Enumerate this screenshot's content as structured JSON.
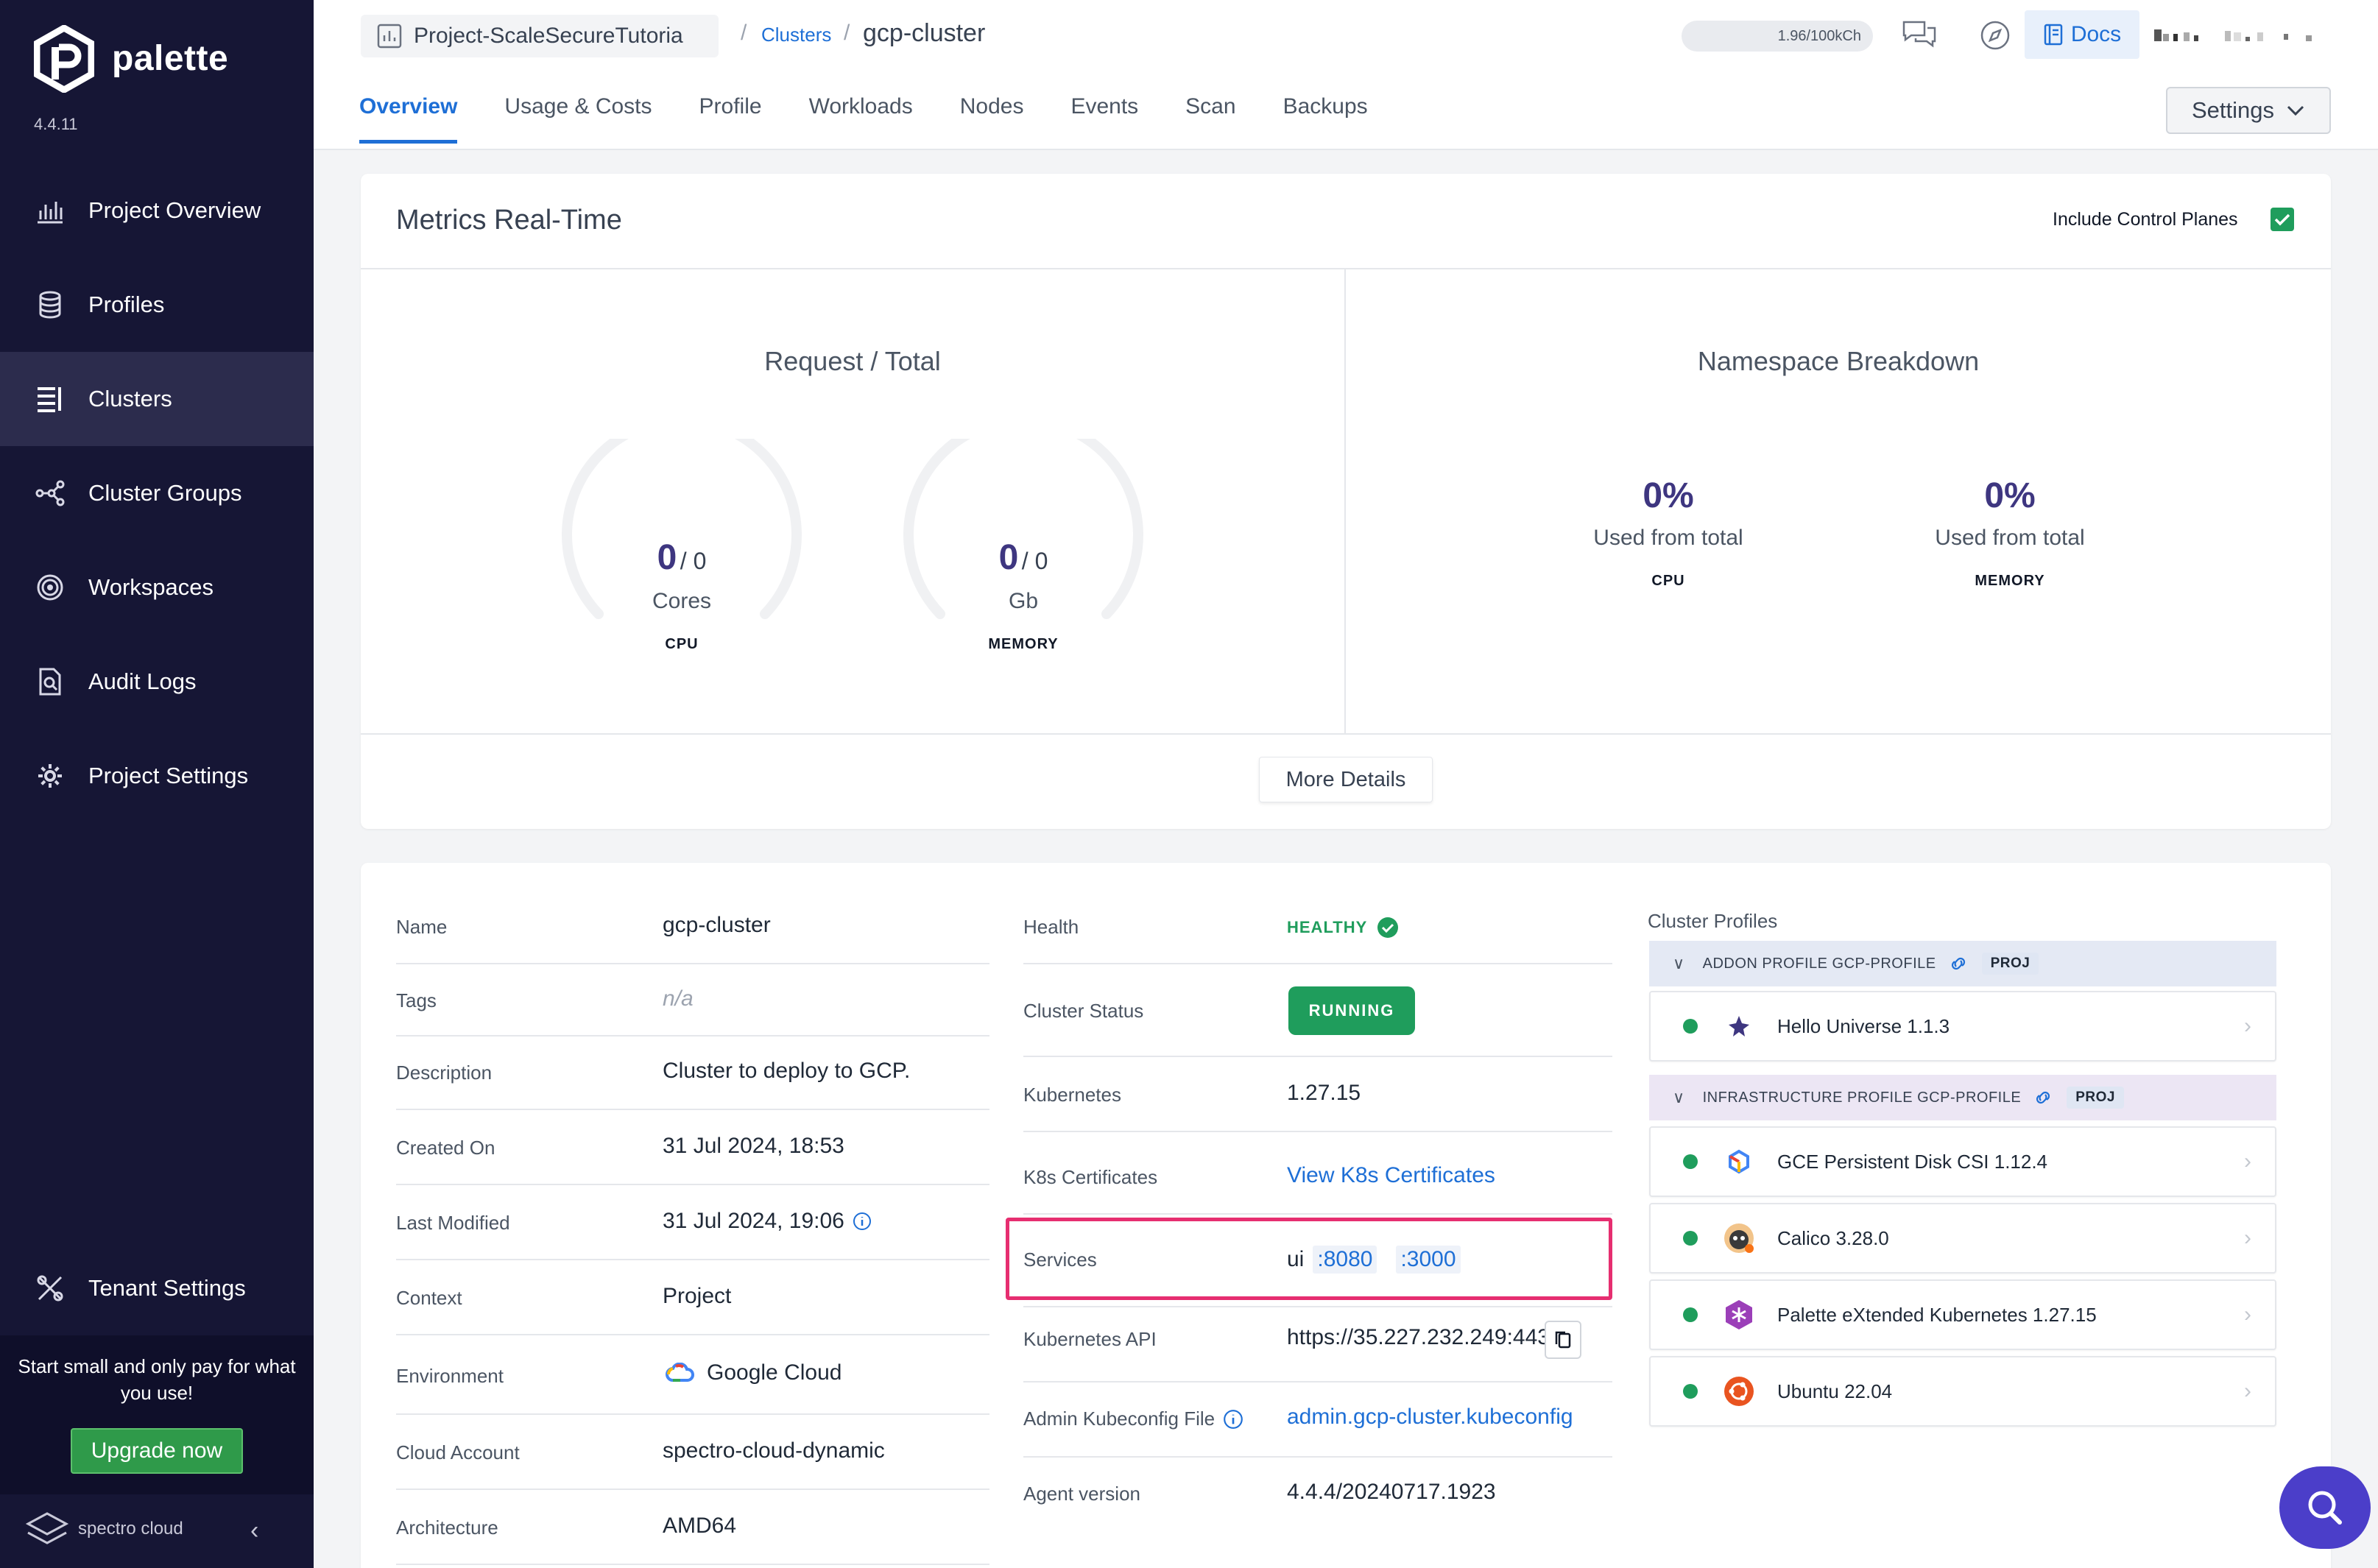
{
  "app": {
    "name": "palette",
    "version": "4.4.11",
    "brand_footer": "spectro cloud"
  },
  "sidebar": {
    "items": [
      {
        "label": "Project Overview",
        "icon": "chart-icon"
      },
      {
        "label": "Profiles",
        "icon": "layers-icon"
      },
      {
        "label": "Clusters",
        "icon": "clusters-icon",
        "active": true
      },
      {
        "label": "Cluster Groups",
        "icon": "nodes-icon"
      },
      {
        "label": "Workspaces",
        "icon": "target-icon"
      },
      {
        "label": "Audit Logs",
        "icon": "search-doc-icon"
      },
      {
        "label": "Project Settings",
        "icon": "gear-icon"
      }
    ],
    "tenant_settings": "Tenant Settings",
    "promo_text": "Start small and only pay for what you use!",
    "upgrade_label": "Upgrade now"
  },
  "header": {
    "project": "Project-ScaleSecureTutoria",
    "breadcrumb_parent": "Clusters",
    "breadcrumb_sep": "/",
    "breadcrumb_current": "gcp-cluster",
    "usage": "1.96/100kCh",
    "docs_label": "Docs",
    "settings_label": "Settings",
    "tabs": [
      "Overview",
      "Usage & Costs",
      "Profile",
      "Workloads",
      "Nodes",
      "Events",
      "Scan",
      "Backups"
    ],
    "active_tab": "Overview"
  },
  "metrics": {
    "title": "Metrics Real-Time",
    "include_control_planes": "Include Control Planes",
    "include_control_planes_checked": true,
    "request_total_title": "Request / Total",
    "cpu": {
      "value": "0",
      "total": "/ 0",
      "unit": "Cores",
      "label": "CPU"
    },
    "memory": {
      "value": "0",
      "total": "/ 0",
      "unit": "Gb",
      "label": "MEMORY"
    },
    "namespace_title": "Namespace Breakdown",
    "ns_cpu": {
      "pct": "0%",
      "sub": "Used from total",
      "label": "CPU"
    },
    "ns_memory": {
      "pct": "0%",
      "sub": "Used from total",
      "label": "MEMORY"
    },
    "more_details": "More Details"
  },
  "details": {
    "left": [
      {
        "label": "Name",
        "value": "gcp-cluster"
      },
      {
        "label": "Tags",
        "value": "n/a"
      },
      {
        "label": "Description",
        "value": "Cluster to deploy to GCP."
      },
      {
        "label": "Created On",
        "value": "31 Jul 2024, 18:53"
      },
      {
        "label": "Last Modified",
        "value": "31 Jul 2024, 19:06"
      },
      {
        "label": "Context",
        "value": "Project"
      },
      {
        "label": "Environment",
        "value": "Google Cloud"
      },
      {
        "label": "Cloud Account",
        "value": "spectro-cloud-dynamic"
      },
      {
        "label": "Architecture",
        "value": "AMD64"
      }
    ],
    "health_label": "Health",
    "health_value": "HEALTHY",
    "status_label": "Cluster Status",
    "status_value": "RUNNING",
    "kubernetes_label": "Kubernetes",
    "kubernetes_value": "1.27.15",
    "certs_label": "K8s Certificates",
    "certs_value": "View K8s Certificates",
    "services_label": "Services",
    "services_name": "ui",
    "services_ports": [
      ":8080",
      ":3000"
    ],
    "api_label": "Kubernetes API",
    "api_value": "https://35.227.232.249:443",
    "kubeconfig_label": "Admin Kubeconfig File",
    "kubeconfig_value": "admin.gcp-cluster.kubeconfig",
    "agent_label": "Agent version",
    "agent_value": "4.4.4/20240717.1923"
  },
  "profiles": {
    "title": "Cluster Profiles",
    "addon": {
      "label": "ADDON PROFILE GCP-PROFILE",
      "badge": "PROJ",
      "color": "#e4e9f4"
    },
    "infra": {
      "label": "INFRASTRUCTURE PROFILE GCP-PROFILE",
      "badge": "PROJ",
      "color": "#ece6f4"
    },
    "addon_items": [
      {
        "name": "Hello Universe 1.1.3",
        "icon": "hello-universe-icon"
      }
    ],
    "infra_items": [
      {
        "name": "GCE Persistent Disk CSI 1.12.4",
        "icon": "gce-icon"
      },
      {
        "name": "Calico 3.28.0",
        "icon": "calico-icon"
      },
      {
        "name": "Palette eXtended Kubernetes 1.27.15",
        "icon": "kubernetes-icon"
      },
      {
        "name": "Ubuntu 22.04",
        "icon": "ubuntu-icon"
      }
    ]
  },
  "colors": {
    "sidebar": "#161635",
    "accent": "#1e6fd6",
    "success": "#1f9d5c",
    "highlight_border": "#e62e70"
  }
}
